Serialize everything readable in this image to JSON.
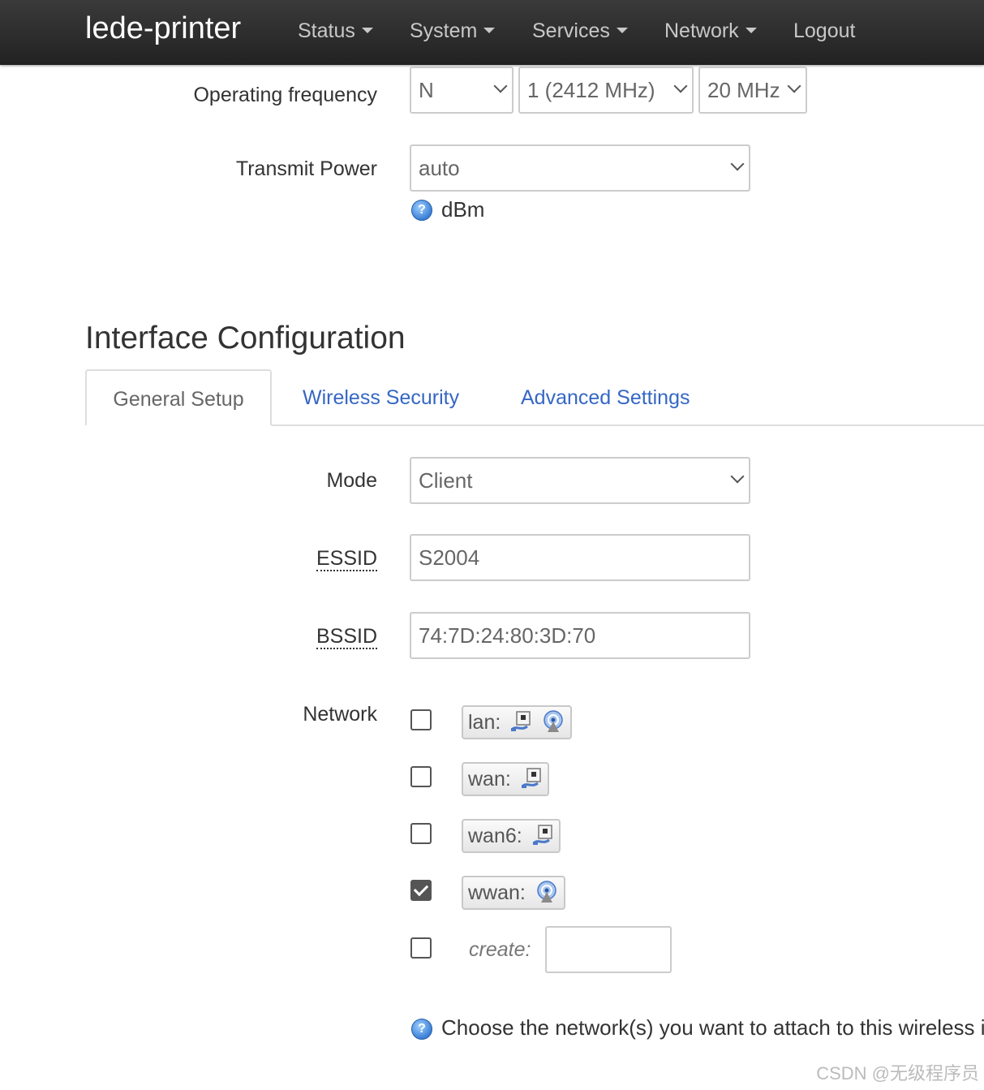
{
  "navbar": {
    "brand": "lede-printer",
    "items": [
      {
        "label": "Status"
      },
      {
        "label": "System"
      },
      {
        "label": "Services"
      },
      {
        "label": "Network"
      },
      {
        "label": "Logout"
      }
    ]
  },
  "device": {
    "operating_frequency": {
      "label": "Operating frequency",
      "mode_value": "N",
      "channel_value": "1 (2412 MHz)",
      "width_value": "20 MHz"
    },
    "transmit_power": {
      "label": "Transmit Power",
      "value": "auto",
      "unit_help": "dBm"
    }
  },
  "interface": {
    "title": "Interface Configuration",
    "tabs": [
      {
        "label": "General Setup",
        "active": true
      },
      {
        "label": "Wireless Security",
        "active": false
      },
      {
        "label": "Advanced Settings",
        "active": false
      }
    ],
    "mode": {
      "label": "Mode",
      "value": "Client"
    },
    "essid": {
      "label": "ESSID",
      "value": "S2004"
    },
    "bssid": {
      "label": "BSSID",
      "value": "74:7D:24:80:3D:70"
    },
    "network": {
      "label": "Network",
      "options": [
        {
          "name": "lan:",
          "checked": false,
          "icons": [
            "ethernet-icon",
            "wifi-icon"
          ]
        },
        {
          "name": "wan:",
          "checked": false,
          "icons": [
            "ethernet-icon"
          ]
        },
        {
          "name": "wan6:",
          "checked": false,
          "icons": [
            "ethernet-icon"
          ]
        },
        {
          "name": "wwan:",
          "checked": true,
          "icons": [
            "wifi-icon"
          ]
        }
      ],
      "create_label": "create:",
      "create_value": "",
      "help": "Choose the network(s) you want to attach to this wireless i"
    }
  },
  "watermark": "CSDN @无级程序员",
  "colors": {
    "navbar_bg": "#2b2b2b",
    "link": "#3567c4",
    "help_icon": "#3c7fd6"
  }
}
